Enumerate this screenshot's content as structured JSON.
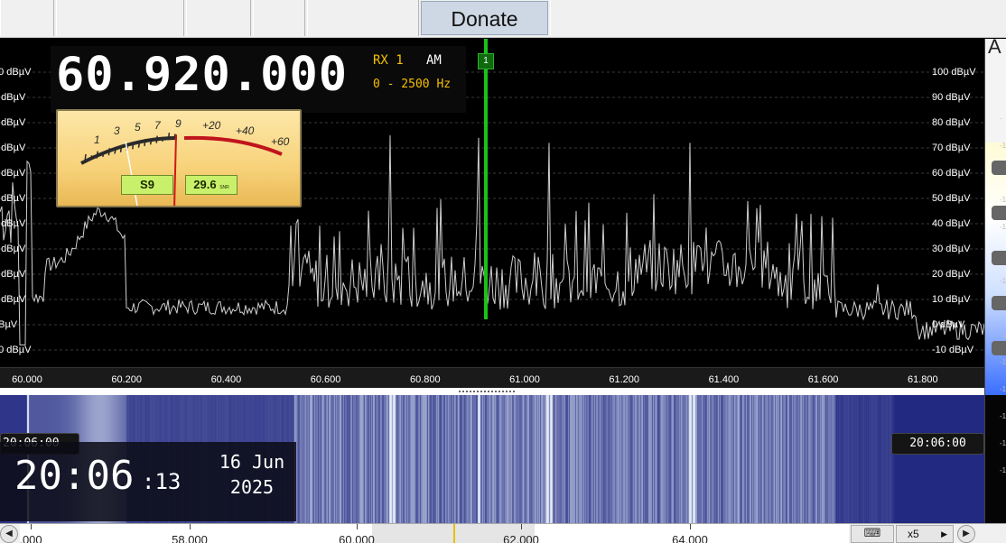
{
  "toolbar": {
    "donate_label": "Donate"
  },
  "receiver": {
    "frequency": "60.920.000",
    "rx": "RX 1",
    "mode": "AM",
    "bandwidth": "0 - 2500 Hz",
    "channel_marker": "1"
  },
  "smeter": {
    "scale_s": [
      "1",
      "3",
      "5",
      "7",
      "9"
    ],
    "scale_over": [
      "+20",
      "+40",
      "+60"
    ],
    "s_reading": "S9",
    "snr_reading": "29.6",
    "snr_unit": "SNR"
  },
  "spectrum": {
    "y_labels_right": [
      "100 dBµV",
      "90 dBµV",
      "80 dBµV",
      "70 dBµV",
      "60 dBµV",
      "50 dBµV",
      "40 dBµV",
      "30 dBµV",
      "20 dBµV",
      "10 dBµV",
      "0 dBµV",
      "-10 dBµV"
    ],
    "y_labels_left": [
      "00 dBµV",
      "0 dBµV",
      "0 dBµV",
      "0 dBµV",
      "0 dBµV",
      "0 dBµV",
      "0 dBµV",
      "0 dBµV",
      "0 dBµV",
      "0 dBµV",
      "dBµV",
      "10 dBµV"
    ],
    "x_labels": [
      "60.000",
      "60.200",
      "60.400",
      "60.600",
      "60.800",
      "61.000",
      "61.200",
      "61.400",
      "61.600",
      "61.800"
    ],
    "trace_color": "#cfcfcf",
    "marker_color": "#19c219"
  },
  "waterfall": {
    "time_left": "20:06:00",
    "time_right": "20:06:00"
  },
  "clock": {
    "time": "20:06",
    "seconds": ":13",
    "day_month": "16 Jun",
    "year": "2025"
  },
  "scale_bar": {
    "ticks": [
      ".000",
      "58.000",
      "60.000",
      "62.000",
      "64.000"
    ],
    "zoom": "x5"
  },
  "side_panel": {
    "glyph": "A",
    "marks": [
      "-",
      "-1",
      "-1",
      "-1",
      "-1",
      "-1",
      "-1",
      "-1",
      "-1",
      "-1",
      "-1",
      "-1",
      "-1",
      "-1"
    ]
  }
}
